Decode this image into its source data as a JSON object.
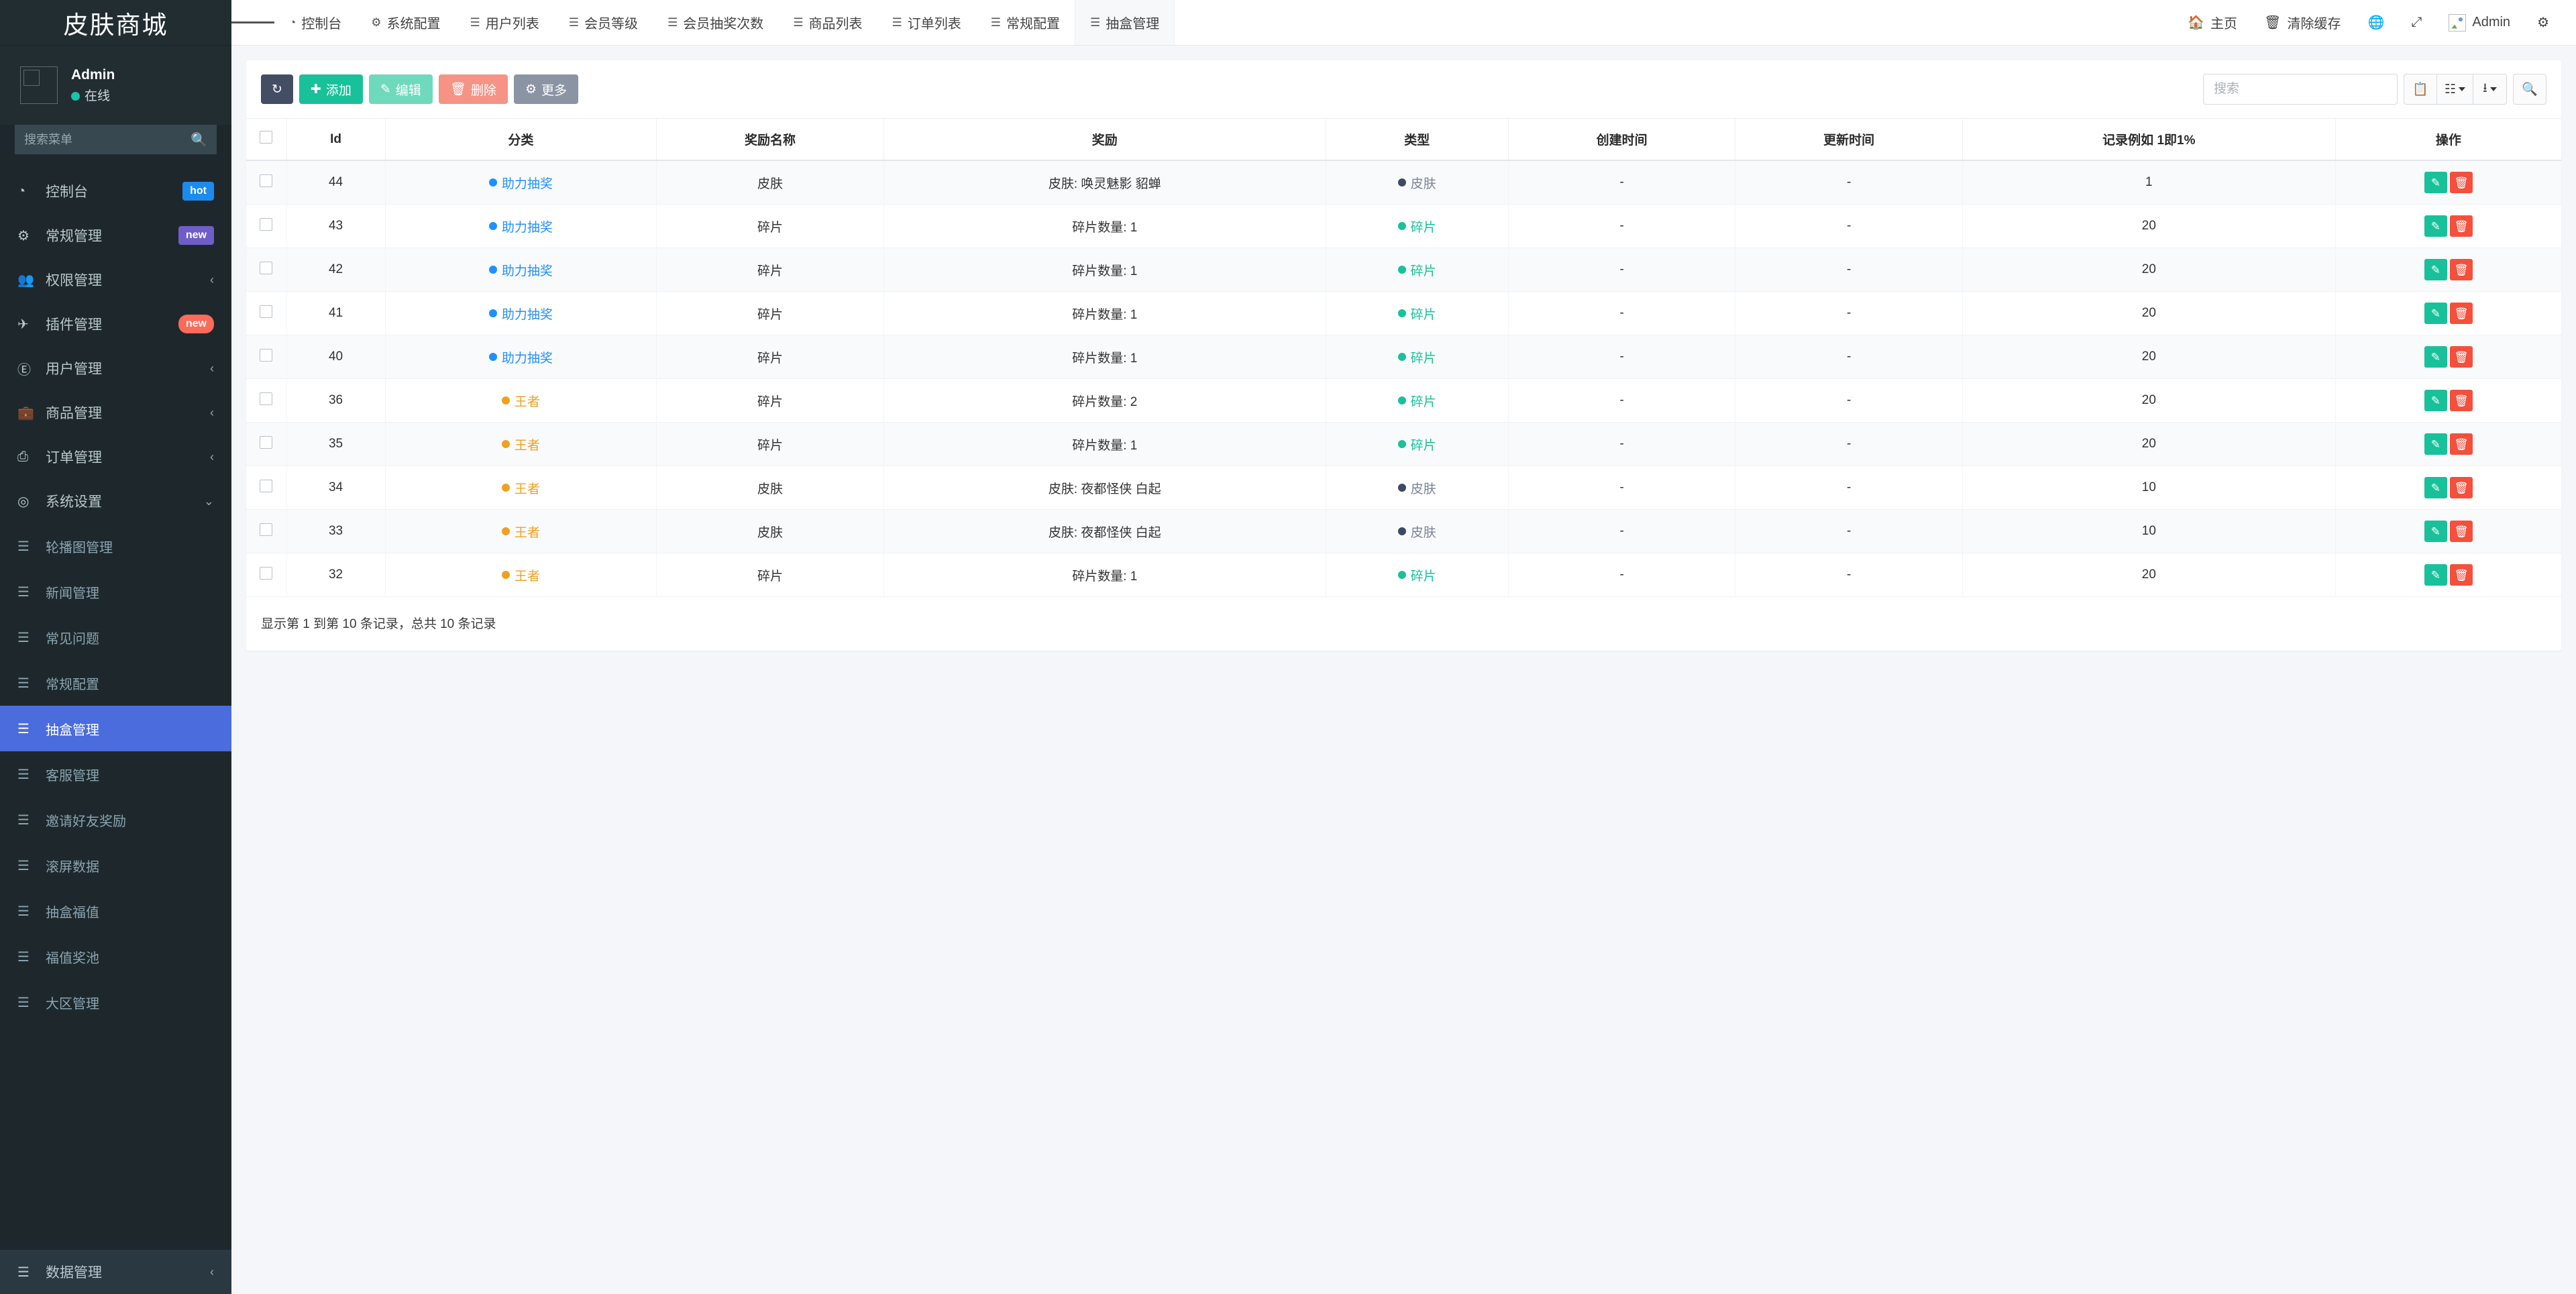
{
  "brand": {
    "title": "皮肤商城"
  },
  "user": {
    "name": "Admin",
    "status": "在线"
  },
  "sidebar": {
    "search_placeholder": "搜索菜单",
    "items": [
      {
        "label": "控制台",
        "icon": "dashboard-icon",
        "badge": "hot",
        "badge_type": "hot"
      },
      {
        "label": "常规管理",
        "icon": "gears-icon",
        "badge": "new",
        "badge_type": "newp"
      },
      {
        "label": "权限管理",
        "icon": "users-icon",
        "chevron": "‹"
      },
      {
        "label": "插件管理",
        "icon": "rocket-icon",
        "badge": "new",
        "badge_type": "newr"
      },
      {
        "label": "用户管理",
        "icon": "user-circle-icon",
        "chevron": "‹"
      },
      {
        "label": "商品管理",
        "icon": "bag-icon",
        "chevron": "‹"
      },
      {
        "label": "订单管理",
        "icon": "printer-icon",
        "chevron": "‹"
      },
      {
        "label": "系统设置",
        "icon": "target-icon",
        "chevron": "⌄",
        "expanded": true
      }
    ],
    "subitems": [
      {
        "label": "轮播图管理"
      },
      {
        "label": "新闻管理"
      },
      {
        "label": "常见问题"
      },
      {
        "label": "常规配置"
      },
      {
        "label": "抽盒管理",
        "active": true
      },
      {
        "label": "客服管理"
      },
      {
        "label": "邀请好友奖励"
      },
      {
        "label": "滚屏数据"
      },
      {
        "label": "抽盒福值"
      },
      {
        "label": "福值奖池"
      },
      {
        "label": "大区管理"
      }
    ],
    "bottom_item": {
      "label": "数据管理",
      "icon": "database-icon",
      "chevron": "‹"
    }
  },
  "topbar": {
    "tabs": [
      {
        "label": "控制台",
        "icon": "dashboard-icon",
        "active": false
      },
      {
        "label": "系统配置",
        "icon": "gear-icon",
        "active": false
      },
      {
        "label": "用户列表",
        "icon": "list-icon",
        "active": false
      },
      {
        "label": "会员等级",
        "icon": "list-icon",
        "active": false
      },
      {
        "label": "会员抽奖次数",
        "icon": "list-icon",
        "active": false
      },
      {
        "label": "商品列表",
        "icon": "list-icon",
        "active": false
      },
      {
        "label": "订单列表",
        "icon": "list-icon",
        "active": false
      },
      {
        "label": "常规配置",
        "icon": "list-icon",
        "active": false
      },
      {
        "label": "抽盒管理",
        "icon": "list-icon",
        "active": true
      }
    ],
    "right": {
      "home": "主页",
      "clear_cache": "清除缓存",
      "username": "Admin"
    }
  },
  "toolbar": {
    "refresh_label": "",
    "add_label": "添加",
    "edit_label": "编辑",
    "delete_label": "删除",
    "more_label": "更多",
    "search_placeholder": "搜索"
  },
  "table": {
    "headers": [
      "",
      "Id",
      "分类",
      "奖励名称",
      "奖励",
      "类型",
      "创建时间",
      "更新时间",
      "记录例如 1即1%",
      "操作"
    ],
    "rows": [
      {
        "id": "44",
        "category": "助力抽奖",
        "category_color": "#1e90ff",
        "reward_name": "皮肤",
        "reward": "皮肤: 唤灵魅影 貂蝉",
        "type": "皮肤",
        "type_color": "#3d4a62",
        "type_text_color": "#7b8494",
        "created": "-",
        "updated": "-",
        "rate": "1"
      },
      {
        "id": "43",
        "category": "助力抽奖",
        "category_color": "#1e90ff",
        "reward_name": "碎片",
        "reward": "碎片数量: 1",
        "type": "碎片",
        "type_color": "#18c19a",
        "type_text_color": "#18c19a",
        "created": "-",
        "updated": "-",
        "rate": "20"
      },
      {
        "id": "42",
        "category": "助力抽奖",
        "category_color": "#1e90ff",
        "reward_name": "碎片",
        "reward": "碎片数量: 1",
        "type": "碎片",
        "type_color": "#18c19a",
        "type_text_color": "#18c19a",
        "created": "-",
        "updated": "-",
        "rate": "20"
      },
      {
        "id": "41",
        "category": "助力抽奖",
        "category_color": "#1e90ff",
        "reward_name": "碎片",
        "reward": "碎片数量: 1",
        "type": "碎片",
        "type_color": "#18c19a",
        "type_text_color": "#18c19a",
        "created": "-",
        "updated": "-",
        "rate": "20"
      },
      {
        "id": "40",
        "category": "助力抽奖",
        "category_color": "#1e90ff",
        "reward_name": "碎片",
        "reward": "碎片数量: 1",
        "type": "碎片",
        "type_color": "#18c19a",
        "type_text_color": "#18c19a",
        "created": "-",
        "updated": "-",
        "rate": "20"
      },
      {
        "id": "36",
        "category": "王者",
        "category_color": "#f0a020",
        "reward_name": "碎片",
        "reward": "碎片数量: 2",
        "type": "碎片",
        "type_color": "#18c19a",
        "type_text_color": "#18c19a",
        "created": "-",
        "updated": "-",
        "rate": "20"
      },
      {
        "id": "35",
        "category": "王者",
        "category_color": "#f0a020",
        "reward_name": "碎片",
        "reward": "碎片数量: 1",
        "type": "碎片",
        "type_color": "#18c19a",
        "type_text_color": "#18c19a",
        "created": "-",
        "updated": "-",
        "rate": "20"
      },
      {
        "id": "34",
        "category": "王者",
        "category_color": "#f0a020",
        "reward_name": "皮肤",
        "reward": "皮肤: 夜都怪侠 白起",
        "type": "皮肤",
        "type_color": "#3d4a62",
        "type_text_color": "#7b8494",
        "created": "-",
        "updated": "-",
        "rate": "10"
      },
      {
        "id": "33",
        "category": "王者",
        "category_color": "#f0a020",
        "reward_name": "皮肤",
        "reward": "皮肤: 夜都怪侠 白起",
        "type": "皮肤",
        "type_color": "#3d4a62",
        "type_text_color": "#7b8494",
        "created": "-",
        "updated": "-",
        "rate": "10"
      },
      {
        "id": "32",
        "category": "王者",
        "category_color": "#f0a020",
        "reward_name": "碎片",
        "reward": "碎片数量: 1",
        "type": "碎片",
        "type_color": "#18c19a",
        "type_text_color": "#18c19a",
        "created": "-",
        "updated": "-",
        "rate": "20"
      }
    ],
    "footer": "显示第 1 到第 10 条记录，总共 10 条记录"
  },
  "colors": {
    "sidebar_bg": "#1e282c",
    "active_menu": "#4a6cdd",
    "accent_green": "#18c19a",
    "accent_red": "#f4503c"
  }
}
